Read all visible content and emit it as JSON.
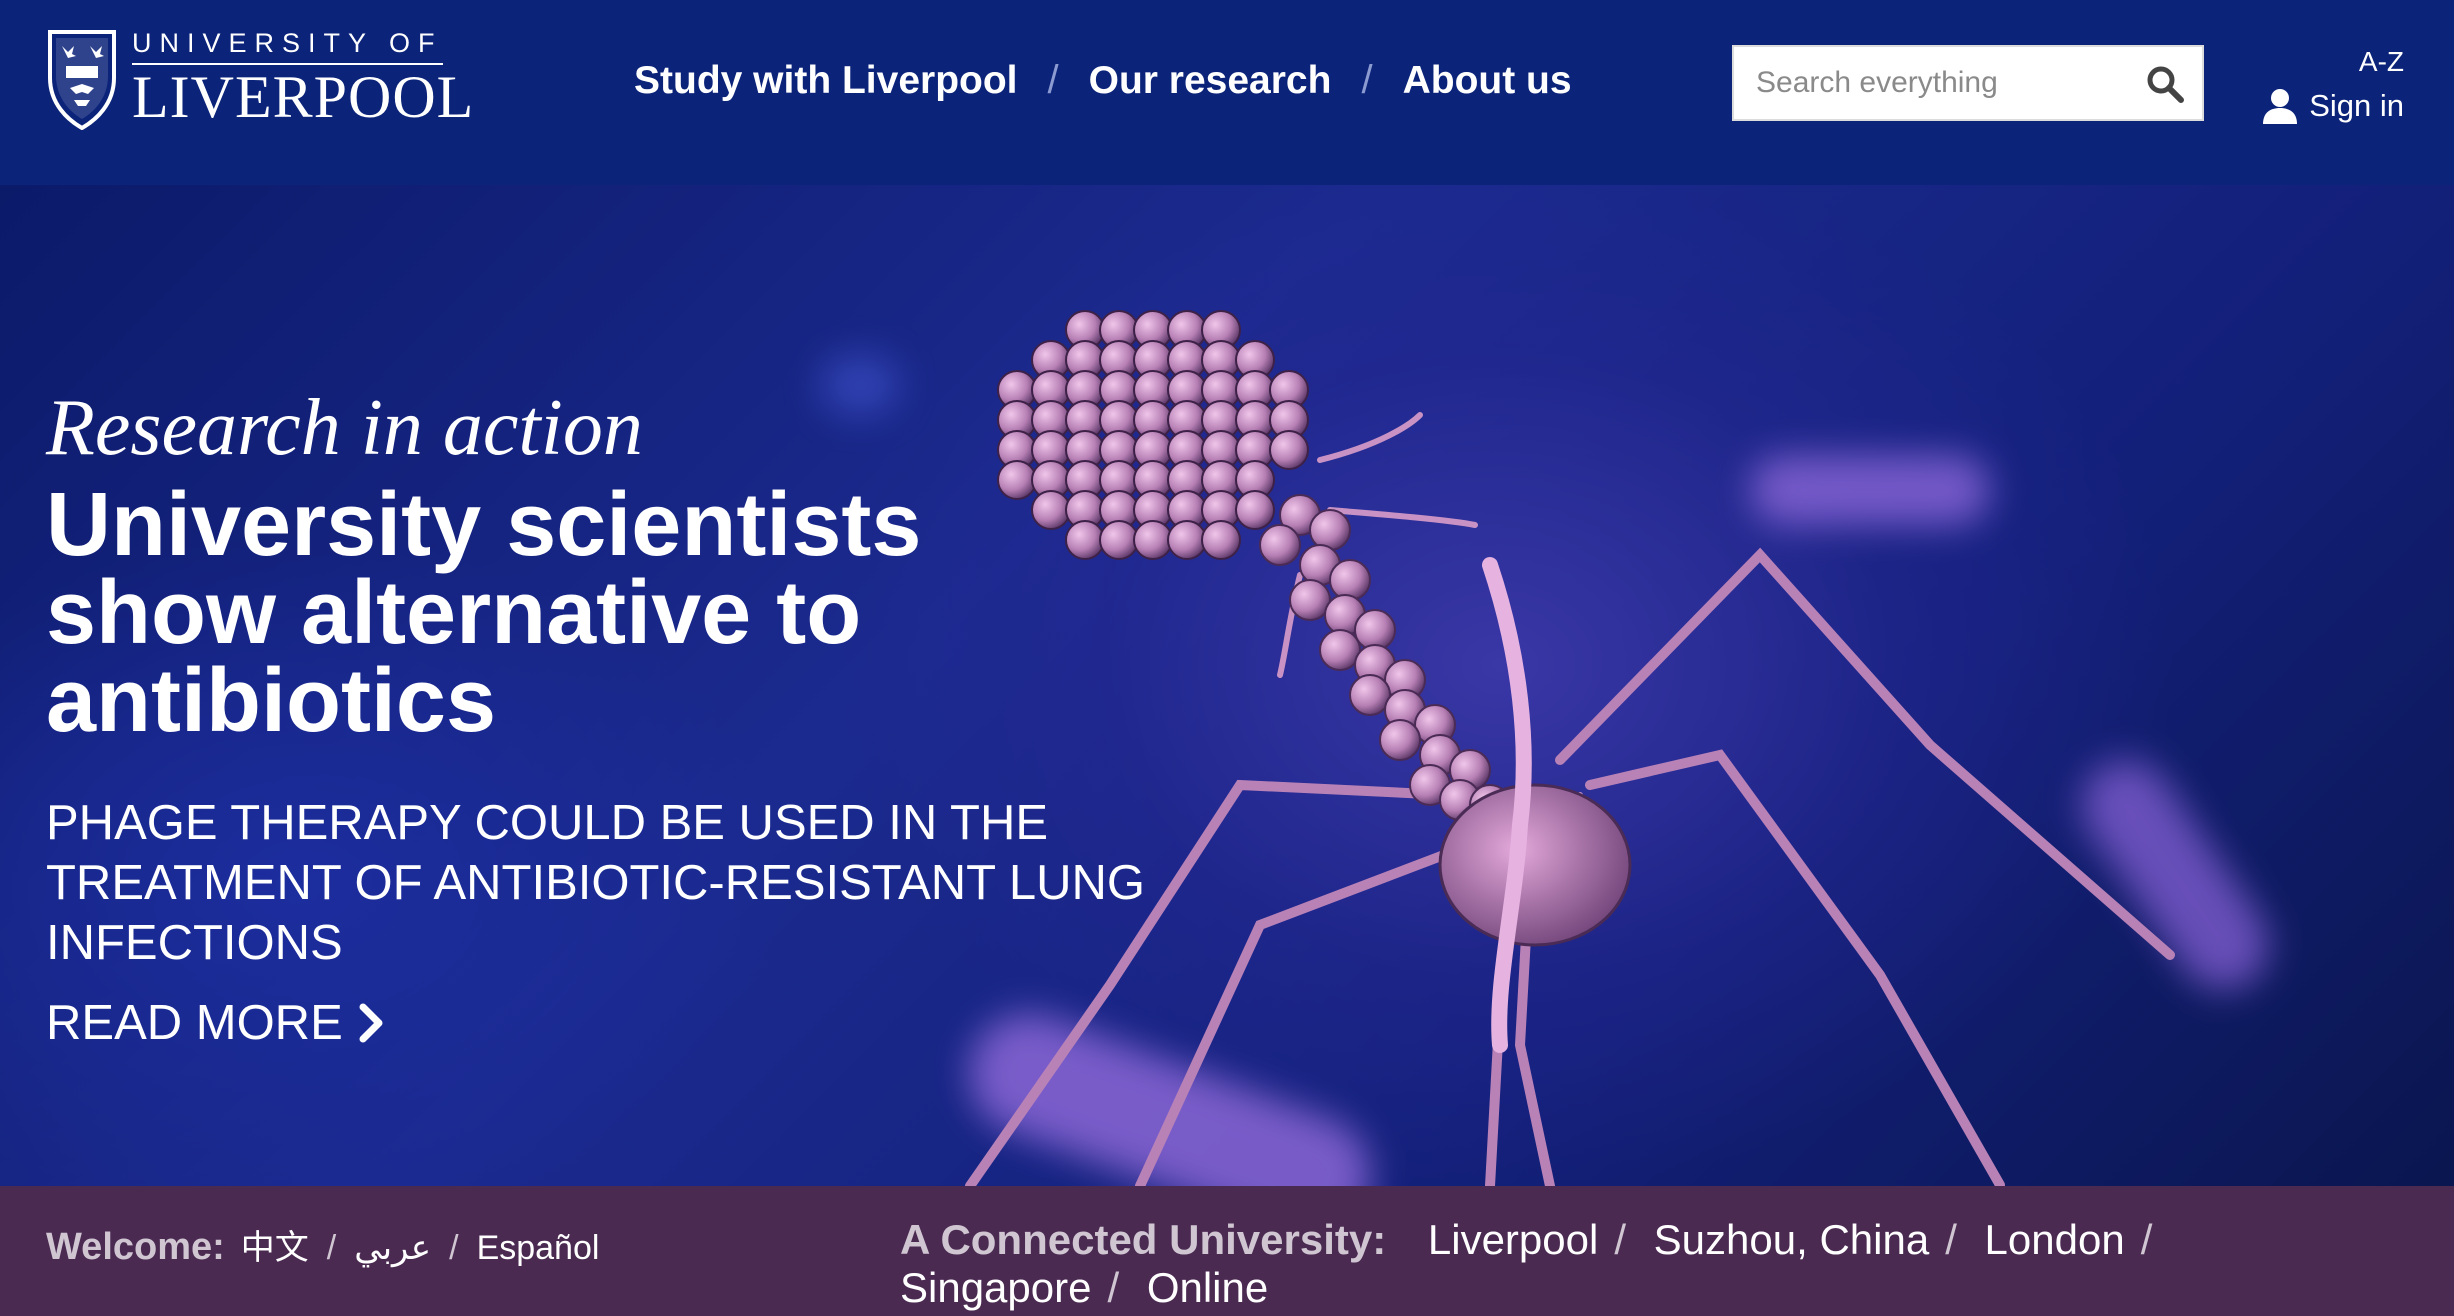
{
  "header": {
    "logo": {
      "top": "UNIVERSITY OF",
      "bottom": "LIVERPOOL"
    },
    "nav": [
      {
        "label": "Study with Liverpool"
      },
      {
        "label": "Our research"
      },
      {
        "label": "About us"
      }
    ],
    "nav_separator": "/",
    "search": {
      "placeholder": "Search everything",
      "icon": "search-icon"
    },
    "az_label": "A-Z",
    "signin_label": "Sign in"
  },
  "hero": {
    "kicker": "Research in action",
    "headline": "University scientists show alternative to antibiotics",
    "subhead": "PHAGE THERAPY COULD BE USED IN THE TREATMENT OF ANTIBIOTIC-RESISTANT LUNG INFECTIONS",
    "read_more": "READ MORE",
    "image_subject": "bacteriophage illustration"
  },
  "footer_bar": {
    "welcome_label": "Welcome:",
    "languages": [
      "中文",
      "عربي",
      "Español"
    ],
    "connected_label": "A Connected University:",
    "campuses": [
      "Liverpool",
      "Suzhou, China",
      "London",
      "Singapore",
      "Online"
    ],
    "separator": "/"
  },
  "colors": {
    "header_bg": "#0b2379",
    "footer_bg": "#4b2a52",
    "text": "#ffffff",
    "phage": "#c58bc0"
  }
}
